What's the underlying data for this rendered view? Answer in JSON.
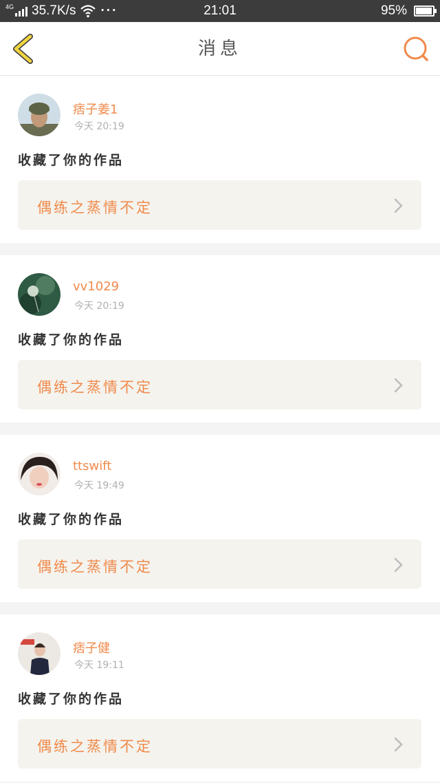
{
  "status_bar": {
    "network": "4G",
    "speed": "35.7K/s",
    "more": "···",
    "time": "21:01",
    "battery": "95%",
    "battery_level": 0.95
  },
  "header": {
    "title": "消息"
  },
  "notifications": [
    {
      "username": "痞子姜1",
      "time": "今天 20:19",
      "action": "收藏了你的作品",
      "work_title": "偶练之蒸情不定",
      "avatar": "soldier-avatar"
    },
    {
      "username": "vv1029",
      "time": "今天 20:19",
      "action": "收藏了你的作品",
      "work_title": "偶练之蒸情不定",
      "avatar": "dandelion-avatar"
    },
    {
      "username": "ttswift",
      "time": "今天 19:49",
      "action": "收藏了你的作品",
      "work_title": "偶练之蒸情不定",
      "avatar": "girl-avatar"
    },
    {
      "username": "痞子健",
      "time": "今天 19:11",
      "action": "收藏了你的作品",
      "work_title": "偶练之蒸情不定",
      "avatar": "person-avatar"
    }
  ],
  "colors": {
    "accent": "#f08a4b",
    "back_arrow": "#f2d640",
    "status_bar": "#3c3c3c",
    "card_box": "#f4f3ee"
  }
}
